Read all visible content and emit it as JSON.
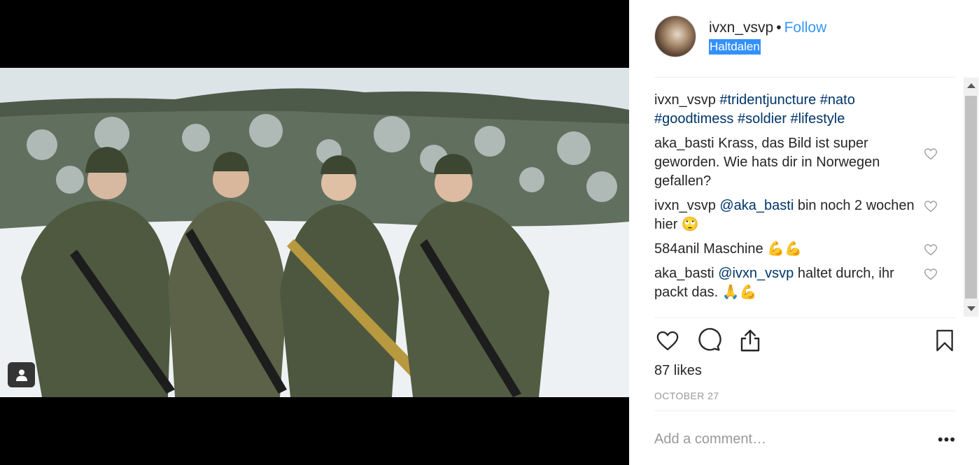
{
  "post": {
    "username": "ivxn_vsvp",
    "separator": "•",
    "follow_label": "Follow",
    "location": "Haltdalen"
  },
  "comments": [
    {
      "author": "ivxn_vsvp",
      "text": "#tridentjuncture #nato #goodtimess #soldier #lifestyle",
      "has_like": false
    },
    {
      "author": "aka_basti",
      "text": "Krass, das Bild ist super geworden. Wie hats dir in Norwegen gefallen?",
      "has_like": true
    },
    {
      "author": "ivxn_vsvp",
      "mention": "@aka_basti",
      "text": "bin noch 2 wochen hier 🙄",
      "has_like": true
    },
    {
      "author": "584anil",
      "text": "Maschine 💪💪",
      "has_like": true
    },
    {
      "author": "aka_basti",
      "mention": "@ivxn_vsvp",
      "text": "haltet durch, ihr packt das. 🙏💪",
      "has_like": true
    }
  ],
  "likes_label": "87 likes",
  "date_label": "OCTOBER 27",
  "add_comment_placeholder": "Add a comment…",
  "more_label": "•••",
  "icons": {
    "like": "heart-icon",
    "comment": "comment-bubble-icon",
    "share": "share-icon",
    "save": "bookmark-icon",
    "tagged": "person-tag-icon"
  },
  "colors": {
    "link": "#3897f0",
    "hashtag": "#003569",
    "location_highlight": "#3390ff",
    "muted": "#999999"
  }
}
